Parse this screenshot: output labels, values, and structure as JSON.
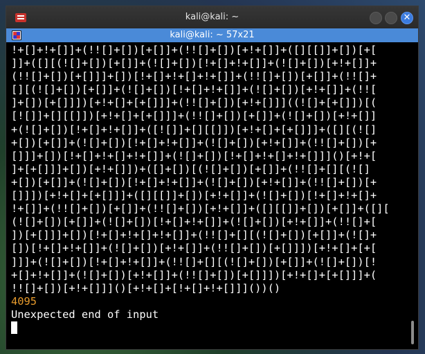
{
  "window": {
    "title": "kali@kali: ~",
    "tab_title": "kali@kali: ~ 57x21",
    "close_glyph": "✕"
  },
  "terminal": {
    "lines": [
      "!+[]+!+[]]+(!![]+[])[+[]]+(!![]+[])[+!+[]]+([][[]]+[])[+[",
      "]]+([][(![]+[])[+[]]+(![]+[])[!+[]+!+[]]+(![]+[])[+!+[]]+",
      "(!![]+[])[+[]]]+[])[!+[]+!+[]+!+[]]+(!![]+[])[+[]]+(!![]+",
      "[][(![]+[])[+[]]+(![]+[])[!+[]+!+[]]+(![]+[])[+!+[]]+(!![",
      "]+[])[+[]]])[+!+[]+[+[]]]+(!![]+[])[+!+[]]]((![]+[+[]])[(",
      "[![]]+[][[]])[+!+[]+[+[]]]+(!![]+[])[+[]]+(![]+[])[+!+[]]",
      "+(![]+[])[!+[]+!+[]]+([![]]+[][[]])[+!+[]+[+[]]]+([][(![]",
      "+[])[+[]]+(![]+[])[!+[]+!+[]]+(![]+[])[+!+[]]+(!![]+[])[+",
      "[]]]+[])[!+[]+!+[]+!+[]]+(![]+[])[!+[]+!+[]+!+[]]]()[+!+[",
      "]+[+[]]]+[])[+!+[]])+([]+[])[(![]+[])[+[]]+(!![]+[][(![]",
      "+[])[+[]]+(![]+[])[!+[]+!+[]]+(![]+[])[+!+[]]+(!![]+[])[+",
      "[]]])[+!+[]+[+[]]]+([][[]]+[])[+!+[]]+(![]+[])[!+[]+!+[]+",
      "!+[]]+(!![]+[])[+[]]+(!![]+[])[+!+[]]+([][[]]+[])[+[]]+([][",
      "(![]+[])[+[]]+(![]+[])[!+[]+!+[]]+(![]+[])[+!+[]]+(!![]+[",
      "])[+[]]]+[])[!+[]+!+[]+!+[]]+(!![]+[][(![]+[])[+[]]+(![]+",
      "[])[!+[]+!+[]]+(![]+[])[+!+[]]+(!![]+[])[+[]]])[+!+[]+[+[",
      "]]]+(![]+[])[!+[]+!+[]]+(!![]+[][(![]+[])[+[]]+(![]+[])[!",
      "+[]+!+[]]+(![]+[])[+!+[]]+(!![]+[])[+[]]])[+!+[]+[+[]]]+(",
      "!![]+[])[+!+[]]]()[+!+[]+[!+[]+!+[]]]())()"
    ],
    "output_number": "4095",
    "error_message": "Unexpected end of input"
  },
  "colors": {
    "tab_bar": "#4a8ad8",
    "number_output": "#e69a2c",
    "close_button": "#3b7bde"
  }
}
